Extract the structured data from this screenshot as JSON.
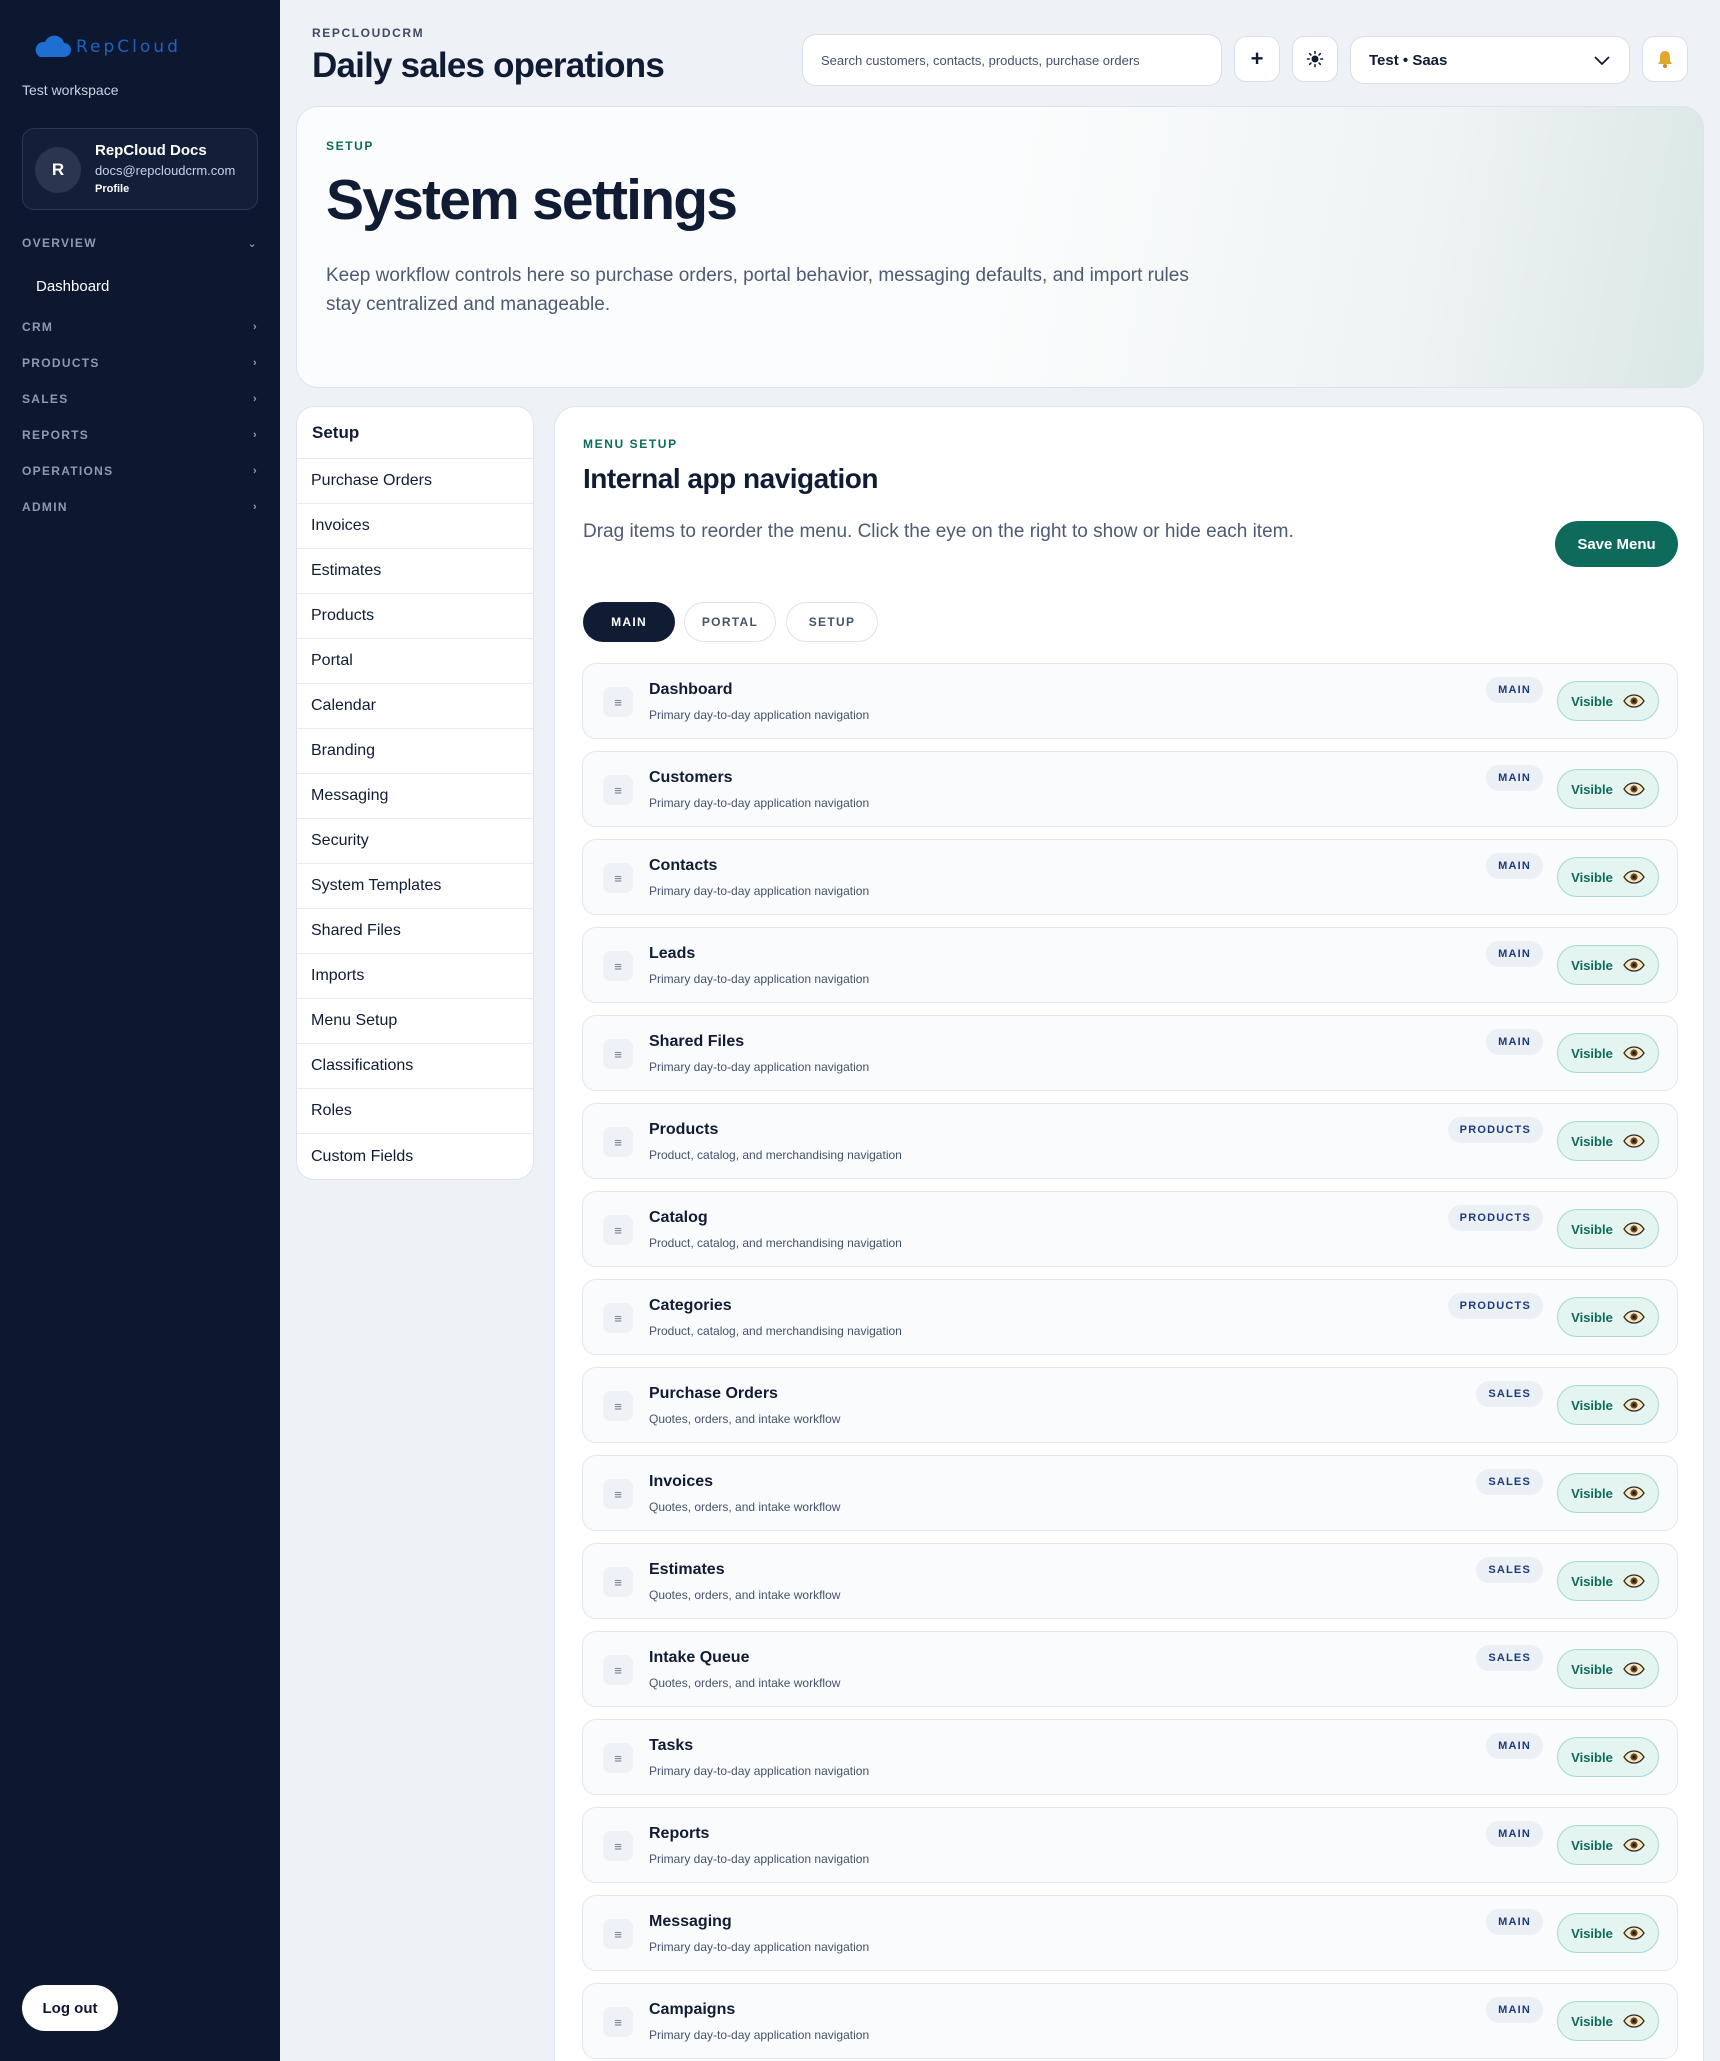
{
  "sidebar": {
    "logo_text": "RepCloud",
    "workspace": "Test workspace",
    "profile": {
      "initial": "R",
      "name": "RepCloud Docs",
      "email": "docs@repcloudcrm.com",
      "link": "Profile"
    },
    "sections": [
      {
        "label": "OVERVIEW",
        "expanded": true
      },
      {
        "label": "CRM",
        "expanded": false
      },
      {
        "label": "PRODUCTS",
        "expanded": false
      },
      {
        "label": "SALES",
        "expanded": false
      },
      {
        "label": "REPORTS",
        "expanded": false
      },
      {
        "label": "OPERATIONS",
        "expanded": false
      },
      {
        "label": "ADMIN",
        "expanded": false
      }
    ],
    "overview_items": [
      "Dashboard"
    ],
    "logout_label": "Log out"
  },
  "header": {
    "brand": "REPCLOUDCRM",
    "title": "Daily sales operations",
    "search_placeholder": "Search customers, contacts, products, purchase orders",
    "add_icon": "plus-icon",
    "theme_icon": "sun-icon",
    "workspace_select": "Test • Saas",
    "notification_icon": "bell-icon"
  },
  "hero": {
    "eyebrow": "SETUP",
    "title": "System settings",
    "description": "Keep workflow controls here so purchase orders, portal behavior, messaging defaults, and import rules stay centralized and manageable."
  },
  "setup_nav": {
    "title": "Setup",
    "items": [
      "Purchase Orders",
      "Invoices",
      "Estimates",
      "Products",
      "Portal",
      "Calendar",
      "Branding",
      "Messaging",
      "Security",
      "System Templates",
      "Shared Files",
      "Imports",
      "Menu Setup",
      "Classifications",
      "Roles",
      "Custom Fields"
    ]
  },
  "menu_setup": {
    "eyebrow": "MENU SETUP",
    "title": "Internal app navigation",
    "description": "Drag items to reorder the menu. Click the eye on the right to show or hide each item.",
    "save_label": "Save Menu",
    "tabs": [
      {
        "label": "MAIN",
        "active": true
      },
      {
        "label": "PORTAL",
        "active": false
      },
      {
        "label": "SETUP",
        "active": false
      }
    ],
    "visible_label": "Visible",
    "items": [
      {
        "label": "Dashboard",
        "desc": "Primary day-to-day application navigation",
        "badge": "MAIN"
      },
      {
        "label": "Customers",
        "desc": "Primary day-to-day application navigation",
        "badge": "MAIN"
      },
      {
        "label": "Contacts",
        "desc": "Primary day-to-day application navigation",
        "badge": "MAIN"
      },
      {
        "label": "Leads",
        "desc": "Primary day-to-day application navigation",
        "badge": "MAIN"
      },
      {
        "label": "Shared Files",
        "desc": "Primary day-to-day application navigation",
        "badge": "MAIN"
      },
      {
        "label": "Products",
        "desc": "Product, catalog, and merchandising navigation",
        "badge": "PRODUCTS"
      },
      {
        "label": "Catalog",
        "desc": "Product, catalog, and merchandising navigation",
        "badge": "PRODUCTS"
      },
      {
        "label": "Categories",
        "desc": "Product, catalog, and merchandising navigation",
        "badge": "PRODUCTS"
      },
      {
        "label": "Purchase Orders",
        "desc": "Quotes, orders, and intake workflow",
        "badge": "SALES"
      },
      {
        "label": "Invoices",
        "desc": "Quotes, orders, and intake workflow",
        "badge": "SALES"
      },
      {
        "label": "Estimates",
        "desc": "Quotes, orders, and intake workflow",
        "badge": "SALES"
      },
      {
        "label": "Intake Queue",
        "desc": "Quotes, orders, and intake workflow",
        "badge": "SALES"
      },
      {
        "label": "Tasks",
        "desc": "Primary day-to-day application navigation",
        "badge": "MAIN"
      },
      {
        "label": "Reports",
        "desc": "Primary day-to-day application navigation",
        "badge": "MAIN"
      },
      {
        "label": "Messaging",
        "desc": "Primary day-to-day application navigation",
        "badge": "MAIN"
      },
      {
        "label": "Campaigns",
        "desc": "Primary day-to-day application navigation",
        "badge": "MAIN"
      }
    ]
  },
  "colors": {
    "sidebar_bg": "#0d1730",
    "accent": "#0e6b5c",
    "logo_blue": "#1e63c4",
    "tab_active": "#0f1c33"
  }
}
